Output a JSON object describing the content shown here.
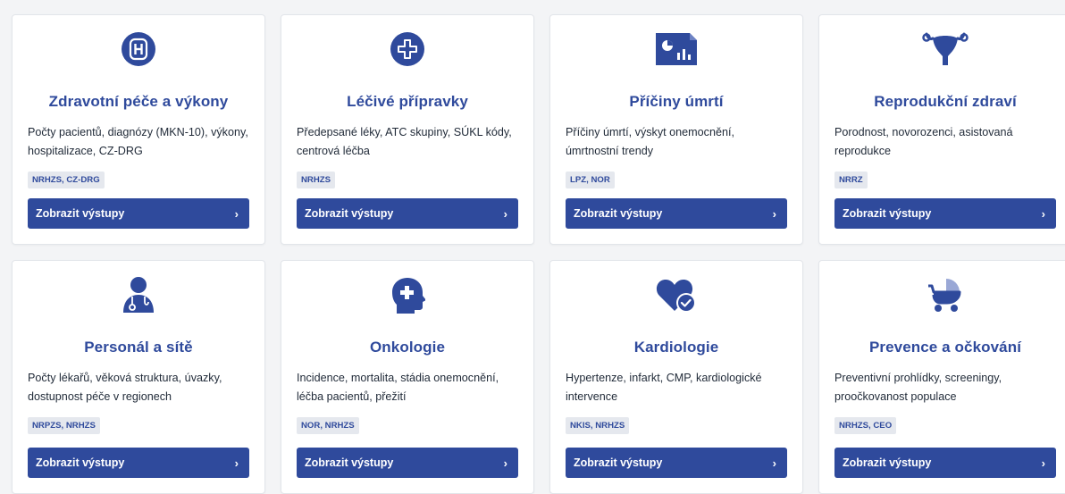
{
  "accent": "#2f4a9c",
  "button_label": "Zobrazit výstupy",
  "cards": [
    {
      "icon": "hospital-icon",
      "title": "Zdravotní péče a výkony",
      "desc": "Počty pacientů, diagnózy (MKN-10), výkony, hospitalizace, CZ-DRG",
      "badge": "NRHZS, CZ-DRG"
    },
    {
      "icon": "plus-circle-icon",
      "title": "Léčivé přípravky",
      "desc": "Předepsané léky, ATC skupiny, SÚKL kódy, centrová léčba",
      "badge": "NRHZS"
    },
    {
      "icon": "file-chart-icon",
      "title": "Příčiny úmrtí",
      "desc": "Příčiny úmrtí, výskyt onemocnění, úmrtnostní trendy",
      "badge": "LPZ, NOR"
    },
    {
      "icon": "uterus-icon",
      "title": "Reprodukční zdraví",
      "desc": "Porodnost, novorozenci, asistovaná reprodukce",
      "badge": "NRRZ"
    },
    {
      "icon": "doctor-icon",
      "title": "Personál a sítě",
      "desc": "Počty lékařů, věková struktura, úvazky, dostupnost péče v regionech",
      "badge": "NRPZS, NRHZS"
    },
    {
      "icon": "head-plus-icon",
      "title": "Onkologie",
      "desc": "Incidence, mortalita, stádia onemocnění, léčba pacientů, přežití",
      "badge": "NOR, NRHZS"
    },
    {
      "icon": "heart-check-icon",
      "title": "Kardiologie",
      "desc": "Hypertenze, infarkt, CMP, kardiologické intervence",
      "badge": "NKIS, NRHZS"
    },
    {
      "icon": "baby-carriage-icon",
      "title": "Prevence a očkování",
      "desc": "Preventivní prohlídky, screeningy, proočkovanost populace",
      "badge": "NRHZS, CEO"
    }
  ]
}
